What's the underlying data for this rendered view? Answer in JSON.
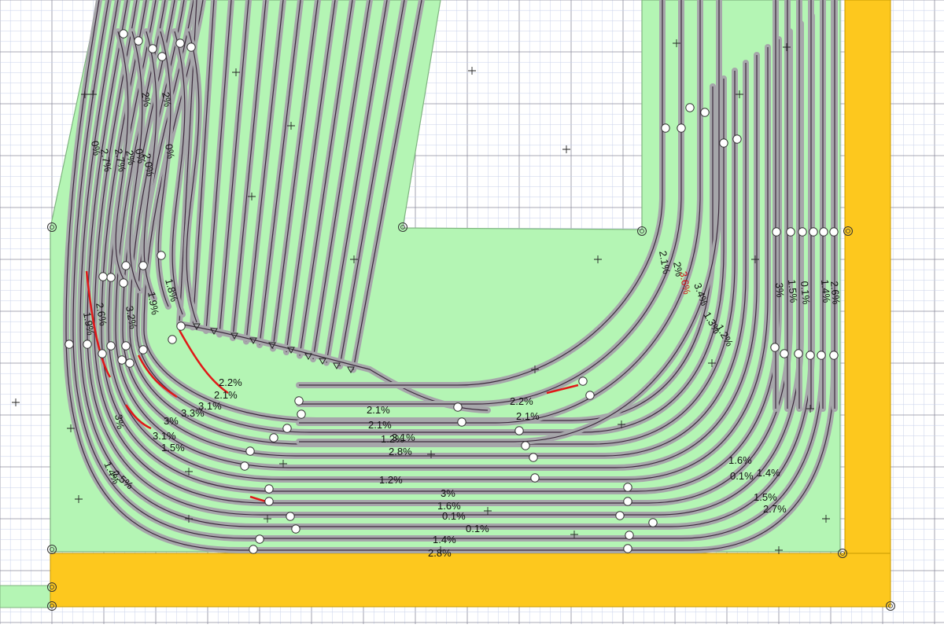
{
  "colors": {
    "background": "#ffffff",
    "grid_minor": "#c8d2ea",
    "grid_major": "#8c8c9c",
    "baseboard_fill": "#b4f5b4",
    "baseboard_edge": "#7fb47f",
    "wall": "#fdc81e",
    "wall_edge": "#c89a00",
    "track_bed": "#a6a6aa",
    "track_rail": "#3c2a3c",
    "steep_grade": "#e01818",
    "joint_fill": "#ffffff",
    "joint_stroke": "#333333",
    "label_text": "#111111"
  },
  "icons": {
    "track_joint": "circle-joint-icon",
    "support_mark": "plus-marker-icon",
    "corner_anchor": "ring-anchor-icon",
    "buffer_stop": "triangle-buffer-icon"
  },
  "grade_labels": [
    {
      "text": "2.7%"
    },
    {
      "text": "0%"
    },
    {
      "text": "2.7%"
    },
    {
      "text": "2%"
    },
    {
      "text": "0%"
    },
    {
      "text": "2.0%"
    },
    {
      "text": "0%"
    },
    {
      "text": "2%"
    },
    {
      "text": "2%"
    },
    {
      "text": "1.9%"
    },
    {
      "text": "2.6%"
    },
    {
      "text": "3.2%"
    },
    {
      "text": "1.9%"
    },
    {
      "text": "1.8%"
    },
    {
      "text": "2.2%"
    },
    {
      "text": "2.1%"
    },
    {
      "text": "3.1%"
    },
    {
      "text": "3.3%"
    },
    {
      "text": "3%"
    },
    {
      "text": "3.1%"
    },
    {
      "text": "1.5%"
    },
    {
      "text": "2.1%"
    },
    {
      "text": "2.1%"
    },
    {
      "text": "3.1%"
    },
    {
      "text": "1.2%"
    },
    {
      "text": "2.8%"
    },
    {
      "text": "1.2%"
    },
    {
      "text": "2.2%"
    },
    {
      "text": "2.1%"
    },
    {
      "text": "3%"
    },
    {
      "text": "1.6%"
    },
    {
      "text": "0.1%"
    },
    {
      "text": "0.1%"
    },
    {
      "text": "1.4%"
    },
    {
      "text": "1.5%"
    },
    {
      "text": "2.7%"
    },
    {
      "text": "3%"
    },
    {
      "text": "1.4%"
    },
    {
      "text": "2.5%"
    },
    {
      "text": "2.8%"
    },
    {
      "text": "2.1%"
    },
    {
      "text": "2%"
    },
    {
      "text": "3.6%",
      "steep": true
    },
    {
      "text": "3.4%"
    },
    {
      "text": "1.3%"
    },
    {
      "text": "1.2%"
    },
    {
      "text": "3%"
    },
    {
      "text": "1.5%"
    },
    {
      "text": "0.1%"
    },
    {
      "text": "1.4%"
    },
    {
      "text": "2.6%"
    },
    {
      "text": "1.6%"
    },
    {
      "text": "0.1%"
    },
    {
      "text": "1.4%"
    }
  ]
}
